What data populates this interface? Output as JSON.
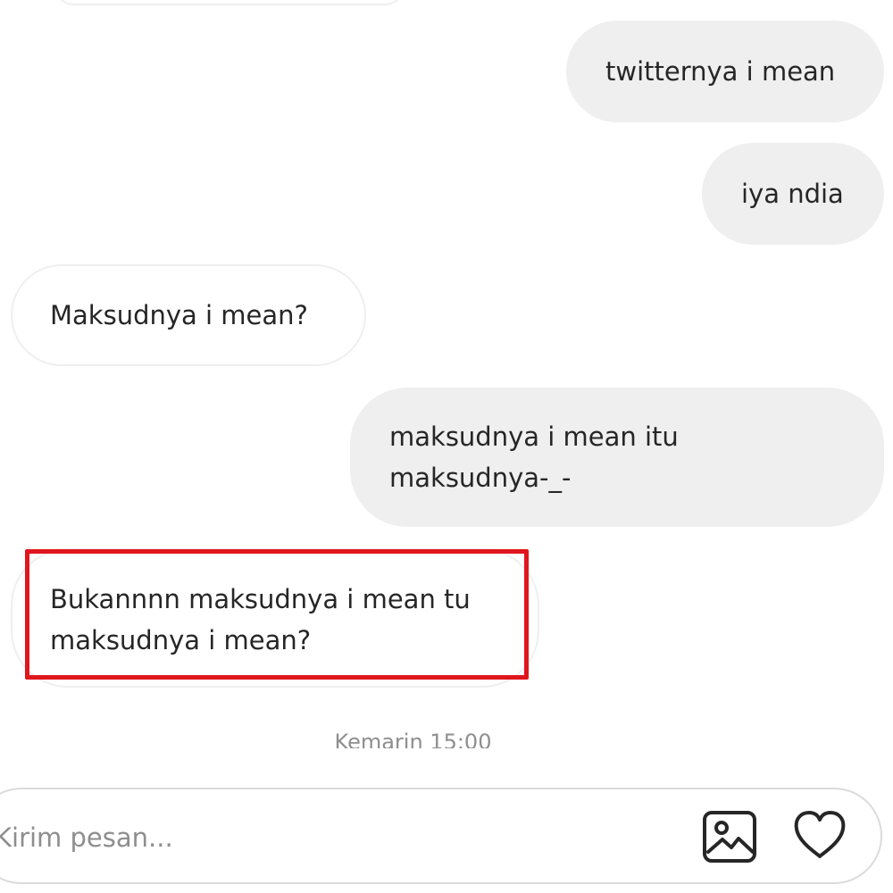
{
  "conversation": {
    "messages": [
      {
        "direction": "out",
        "text": "twitternya i mean"
      },
      {
        "direction": "out",
        "text": "iya ndia"
      },
      {
        "direction": "in",
        "text": "Maksudnya i mean?"
      },
      {
        "direction": "out",
        "text": "maksudnya i mean itu\nmaksudnya-_-"
      },
      {
        "direction": "in",
        "text": "Bukannnn maksudnya i mean tu\nmaksudnya i mean?",
        "highlighted": true
      }
    ],
    "timestamp": "Kemarin 15:00"
  },
  "composer": {
    "placeholder": "Kirim pesan...",
    "value": "",
    "icons": {
      "image": "image-icon",
      "heart": "heart-icon"
    }
  },
  "colors": {
    "outgoing_bubble": "#efefef",
    "incoming_border": "#efefef",
    "highlight": "#e0161d",
    "text": "#262626",
    "muted": "#8e8e8e"
  }
}
